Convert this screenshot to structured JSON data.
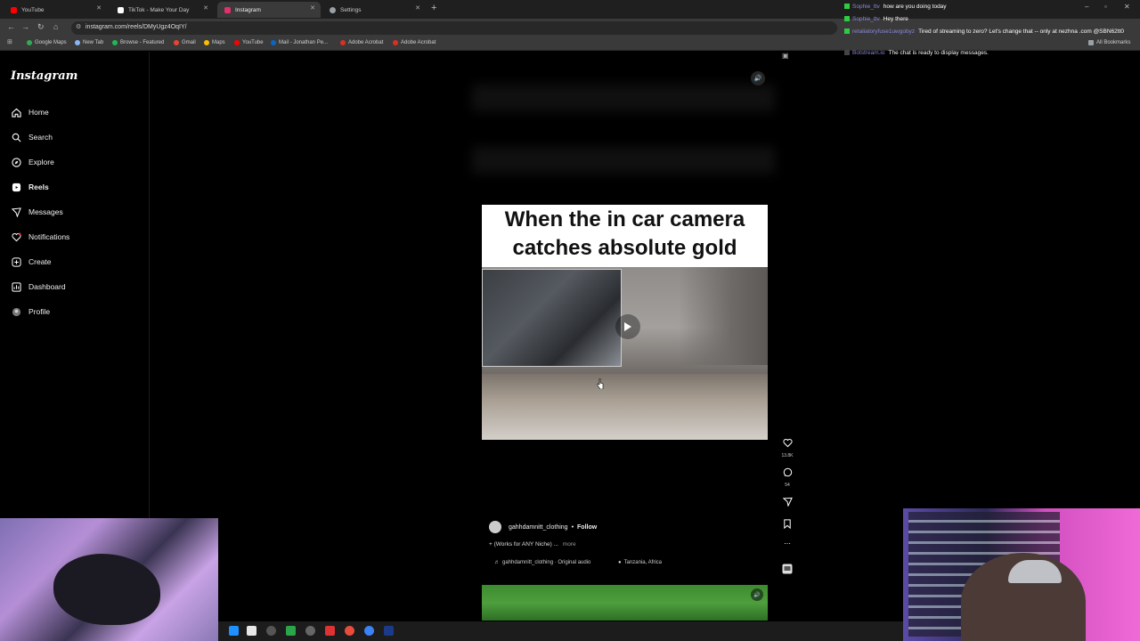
{
  "browser": {
    "tabs": [
      {
        "label": "YouTube",
        "color": "#ff0000"
      },
      {
        "label": "TikTok - Make Your Day",
        "color": "#ffffff"
      },
      {
        "label": "Instagram",
        "color": "#e1306c"
      },
      {
        "label": "Settings",
        "color": "#9aa0a6"
      }
    ],
    "url": "instagram.com/reels/DMyUgz4OqIY/",
    "bookmarks": [
      "Google Maps",
      "New Tab",
      "Browse - Featured",
      "Gmail",
      "Maps",
      "YouTube",
      "Mail - Jonathan Pe...",
      "Adobe Acrobat",
      "Adobe Acrobat"
    ],
    "all_bookmarks": "All Bookmarks"
  },
  "instagram": {
    "logo": "Instagram",
    "nav": [
      {
        "label": "Home",
        "icon": "home-icon"
      },
      {
        "label": "Search",
        "icon": "search-icon"
      },
      {
        "label": "Explore",
        "icon": "compass-icon"
      },
      {
        "label": "Reels",
        "icon": "reels-icon"
      },
      {
        "label": "Messages",
        "icon": "messenger-icon"
      },
      {
        "label": "Notifications",
        "icon": "heart-icon"
      },
      {
        "label": "Create",
        "icon": "plus-icon"
      },
      {
        "label": "Dashboard",
        "icon": "dashboard-icon"
      },
      {
        "label": "Profile",
        "icon": "profile-icon"
      }
    ]
  },
  "reel": {
    "caption_line1": "When the in car camera",
    "caption_line2": "catches absolute gold",
    "likes": "13.8K",
    "comments": "54",
    "author": "gahhdamnitt_clothing",
    "dot": "•",
    "follow": "Follow",
    "description": "+ (Works for ANY Niche) ...",
    "more": "more",
    "audio": "gahhdamnitt_clothing · Original audio",
    "location": "Tanzania, Africa"
  },
  "chat": [
    {
      "user": "Sophie_ttv",
      "text": "how are you doing today"
    },
    {
      "user": "Sophie_ttv",
      "text": "Hey there"
    },
    {
      "user": "retaliatoryfuse1uwgobyz",
      "text": "Tired of streaming to zero? Let's change that -- only at nezhna .com @SBN62tt0"
    },
    {
      "user": "Botstream.io",
      "text": "The chat is ready to display messages."
    }
  ]
}
